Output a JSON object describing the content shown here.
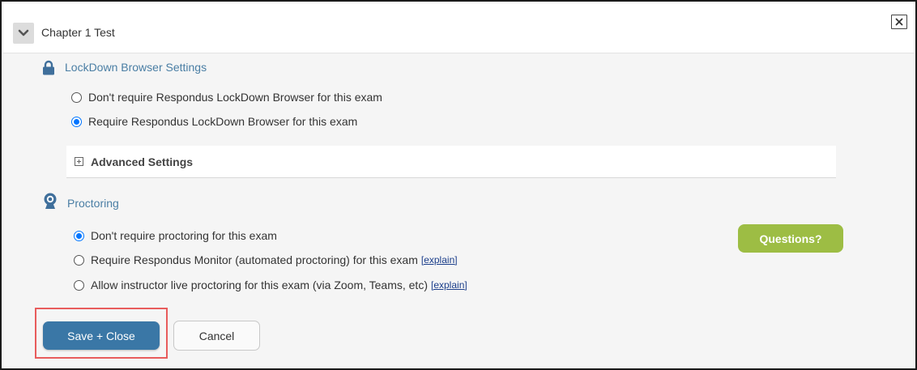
{
  "header": {
    "title": "Chapter 1 Test",
    "toggle_icon": "chevron-down-icon",
    "close_icon": "close-box-icon"
  },
  "lockdown": {
    "section_title": "LockDown Browser Settings",
    "icon": "lock-icon",
    "options": [
      {
        "label": "Don't require Respondus LockDown Browser for this exam",
        "selected": false
      },
      {
        "label": "Require Respondus LockDown Browser for this exam",
        "selected": true
      }
    ],
    "advanced_label": "Advanced Settings"
  },
  "proctoring": {
    "section_title": "Proctoring",
    "icon": "webcam-icon",
    "options": [
      {
        "label": "Don't require proctoring for this exam",
        "selected": true,
        "link": ""
      },
      {
        "label": "Require Respondus Monitor (automated proctoring) for this exam",
        "selected": false,
        "link": "[explain]"
      },
      {
        "label": "Allow instructor live proctoring for this exam (via Zoom, Teams, etc)",
        "selected": false,
        "link": "[explain]"
      }
    ],
    "questions_label": "Questions?"
  },
  "actions": {
    "save_label": "Save + Close",
    "cancel_label": "Cancel"
  },
  "colors": {
    "accent_blue": "#3a77a6",
    "section_title": "#4a7ea4",
    "questions_green": "#9dbd44",
    "highlight_red": "#e85c5c"
  }
}
